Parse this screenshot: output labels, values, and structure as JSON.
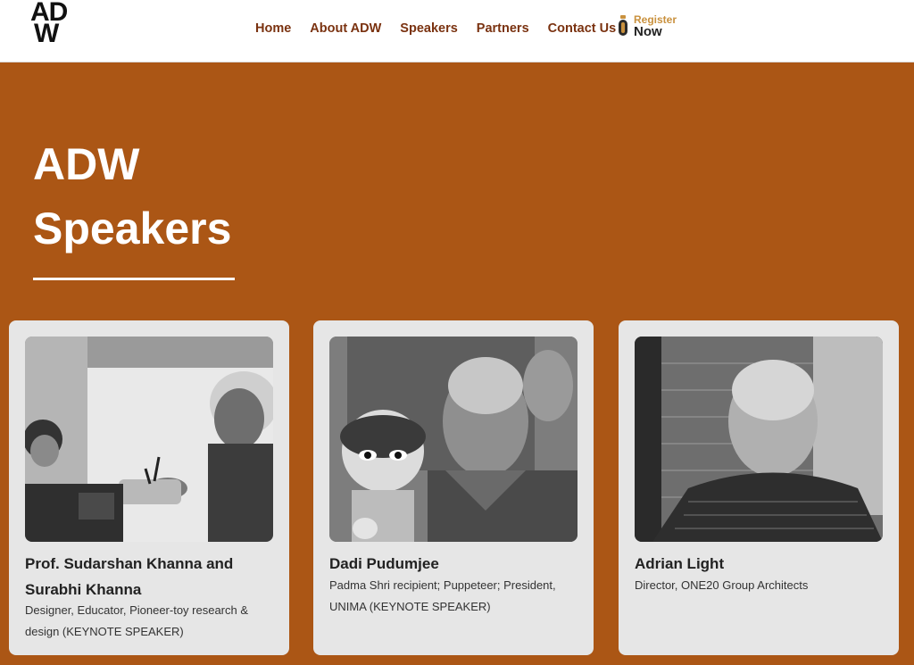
{
  "header": {
    "logo_line1": "AD",
    "logo_line2": "W",
    "nav": [
      "Home",
      "About ADW",
      "Speakers",
      "Partners",
      "Contact Us"
    ],
    "register_line1": "Register",
    "register_line2": "Now"
  },
  "hero": {
    "title_line1": "ADW",
    "title_line2": "Speakers"
  },
  "speakers": [
    {
      "name": "Prof. Sudarshan Khanna and Surabhi Khanna",
      "role": "Designer, Educator, Pioneer-toy research & design (KEYNOTE SPEAKER)"
    },
    {
      "name": "Dadi Pudumjee",
      "role": "Padma Shri recipient; Puppeteer; President, UNIMA (KEYNOTE SPEAKER)"
    },
    {
      "name": "Adrian Light",
      "role": "Director, ONE20 Group Architects"
    }
  ],
  "colors": {
    "hero_bg": "#ab5615",
    "nav_text": "#7a3210",
    "card_bg": "#e6e6e6",
    "register_accent": "#c9913e"
  }
}
